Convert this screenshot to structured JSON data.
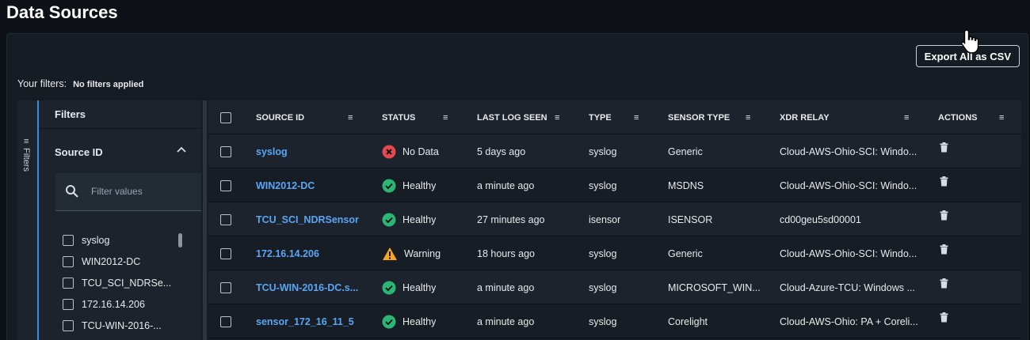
{
  "page": {
    "title": "Data Sources"
  },
  "toolbar": {
    "export_label": "Export All as CSV"
  },
  "filters_summary": {
    "label": "Your filters:",
    "value": "No filters applied"
  },
  "filter_panel": {
    "rail_label": "Filters",
    "title": "Filters",
    "section_title": "Source ID",
    "search_placeholder": "Filter values",
    "options": [
      "syslog",
      "WIN2012-DC",
      "TCU_SCI_NDRSe...",
      "172.16.14.206",
      "TCU-WIN-2016-..."
    ]
  },
  "table": {
    "columns": [
      "SOURCE ID",
      "STATUS",
      "LAST LOG SEEN",
      "TYPE",
      "SENSOR TYPE",
      "XDR RELAY",
      "ACTIONS"
    ],
    "rows": [
      {
        "source_id": "syslog",
        "status": "No Data",
        "status_kind": "error",
        "last_log": "5 days ago",
        "type": "syslog",
        "sensor_type": "Generic",
        "relay": "Cloud-AWS-Ohio-SCI: Windo..."
      },
      {
        "source_id": "WIN2012-DC",
        "status": "Healthy",
        "status_kind": "ok",
        "last_log": "a minute ago",
        "type": "syslog",
        "sensor_type": "MSDNS",
        "relay": "Cloud-AWS-Ohio-SCI: Windo..."
      },
      {
        "source_id": "TCU_SCI_NDRSensor",
        "status": "Healthy",
        "status_kind": "ok",
        "last_log": "27 minutes ago",
        "type": "isensor",
        "sensor_type": "ISENSOR",
        "relay": "cd00geu5sd00001"
      },
      {
        "source_id": "172.16.14.206",
        "status": "Warning",
        "status_kind": "warn",
        "last_log": "18 hours ago",
        "type": "syslog",
        "sensor_type": "Generic",
        "relay": "Cloud-AWS-Ohio-SCI: Windo..."
      },
      {
        "source_id": "TCU-WIN-2016-DC.s...",
        "status": "Healthy",
        "status_kind": "ok",
        "last_log": "a minute ago",
        "type": "syslog",
        "sensor_type": "MICROSOFT_WIN...",
        "relay": "Cloud-Azure-TCU: Windows ..."
      },
      {
        "source_id": "sensor_172_16_11_5",
        "status": "Healthy",
        "status_kind": "ok",
        "last_log": "a minute ago",
        "type": "syslog",
        "sensor_type": "Corelight",
        "relay": "Cloud-AWS-Ohio: PA + Coreli..."
      }
    ]
  },
  "colors": {
    "accent": "#3b8beb",
    "link": "#5aa6f5",
    "ok": "#2bb673",
    "error": "#e5484d",
    "warn": "#f5a623"
  }
}
